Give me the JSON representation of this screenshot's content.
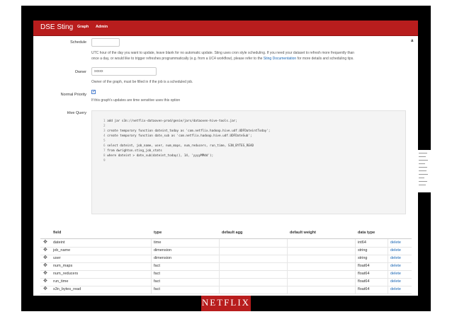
{
  "navbar": {
    "title": "DSE Sting",
    "links": [
      "Graph",
      "Admin"
    ]
  },
  "form": {
    "schedule": {
      "label": "Schedule",
      "value": "",
      "help_line1": "UTC hour of the day you want to update, leave blank for no automatic update. Sting uses cron style scheduling. If you need your dataset to refresh more frequently than",
      "help_line2": "once a day, or would like to trigger refreshes programmatically (e.g. from a UC4 workflow), please refer to the",
      "help_link": "Sting Documentation",
      "help_line3": "for more details and scheduling tips."
    },
    "owner": {
      "label": "Owner",
      "value": "xxxxx",
      "help": "Owner of the graph, must be filled in if the job is a scheduled job."
    },
    "priority": {
      "label": "Normal Priority",
      "checked": true,
      "help": "If this graph's updates are time sensitive uses this option"
    },
    "hive": {
      "label": "Hive Query",
      "lines": [
        {
          "n": "1",
          "text": "add jar s3n://netflix-dataoven-prod/genie/jars/dataoven-hive-tools.jar;"
        },
        {
          "n": "2",
          "text": ""
        },
        {
          "n": "3",
          "text": "create temporary function dateint_today as 'com.netflix.hadoop.hive.udf.UDFDateintToday';"
        },
        {
          "n": "4",
          "text": "create temporary function date_sub as 'com.netflix.hadoop.hive.udf.UDFDateSub';"
        },
        {
          "n": "5",
          "text": ""
        },
        {
          "n": "6",
          "text": "select dateint, job_name, user, num_maps, num_reducers, run_time, S3N_BYTES_READ"
        },
        {
          "n": "7",
          "text": "from dwrighton.sting_job_stats"
        },
        {
          "n": "8",
          "text": "where dateint > date_sub(dateint_today(), 14, 'yyyyMMdd');"
        },
        {
          "n": "9",
          "text": ""
        }
      ]
    }
  },
  "table": {
    "headers": [
      "field",
      "type",
      "default agg",
      "default weight",
      "data type"
    ],
    "rows": [
      {
        "field": "dateint",
        "type": "time",
        "agg": "",
        "weight": "",
        "dtype": "int64",
        "action": "delete"
      },
      {
        "field": "job_name",
        "type": "dimension",
        "agg": "",
        "weight": "",
        "dtype": "string",
        "action": "delete"
      },
      {
        "field": "user",
        "type": "dimension",
        "agg": "",
        "weight": "",
        "dtype": "string",
        "action": "delete"
      },
      {
        "field": "num_maps",
        "type": "fact",
        "agg": "",
        "weight": "",
        "dtype": "float64",
        "action": "delete"
      },
      {
        "field": "num_reducers",
        "type": "fact",
        "agg": "",
        "weight": "",
        "dtype": "float64",
        "action": "delete"
      },
      {
        "field": "run_time",
        "type": "fact",
        "agg": "",
        "weight": "",
        "dtype": "float64",
        "action": "delete"
      },
      {
        "field": "s3n_bytes_read",
        "type": "fact",
        "agg": "",
        "weight": "",
        "dtype": "float64",
        "action": "delete"
      }
    ]
  },
  "footer_logo": "NETFLIX",
  "right_edge_letter": "a",
  "colors": {
    "brand_red": "#b81d1d",
    "link_blue": "#1a66b3"
  }
}
